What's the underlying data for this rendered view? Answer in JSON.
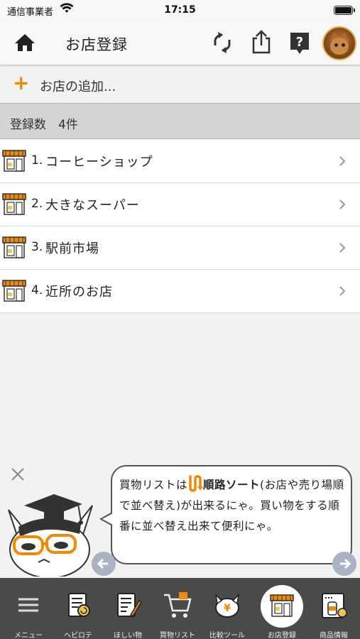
{
  "status_bar": {
    "carrier": "通信事業者",
    "time": "17:15"
  },
  "header": {
    "title": "お店登録"
  },
  "add_row": {
    "label": "お店の追加..."
  },
  "section": {
    "label": "登録数",
    "count": "4件"
  },
  "stores": [
    {
      "num": "1.",
      "name": "コーヒーショップ"
    },
    {
      "num": "2.",
      "name": "大きなスーパー"
    },
    {
      "num": "3.",
      "name": "駅前市場"
    },
    {
      "num": "4.",
      "name": "近所のお店"
    }
  ],
  "tip": {
    "prefix": "買物リストは",
    "highlight": "順路ソート",
    "suffix": "(お店や売り場順で並べ替え)が出来るにゃ。買い物をする順番に並べ替え出来て便利にゃ。"
  },
  "tabs": [
    {
      "label": "メニュー",
      "icon": "menu-icon"
    },
    {
      "label": "ヘビロテ",
      "icon": "heavy-rotation-icon"
    },
    {
      "label": "ほしい物",
      "icon": "wishlist-icon"
    },
    {
      "label": "買物リスト",
      "icon": "cart-icon"
    },
    {
      "label": "比較ツール",
      "icon": "compare-cat-icon"
    },
    {
      "label": "お店登録",
      "icon": "store-icon",
      "active": true
    },
    {
      "label": "商品情報",
      "icon": "product-info-icon"
    }
  ],
  "colors": {
    "accent": "#f18a00",
    "tab_bar": "#4a4a4a",
    "section": "#d4d4d4"
  }
}
